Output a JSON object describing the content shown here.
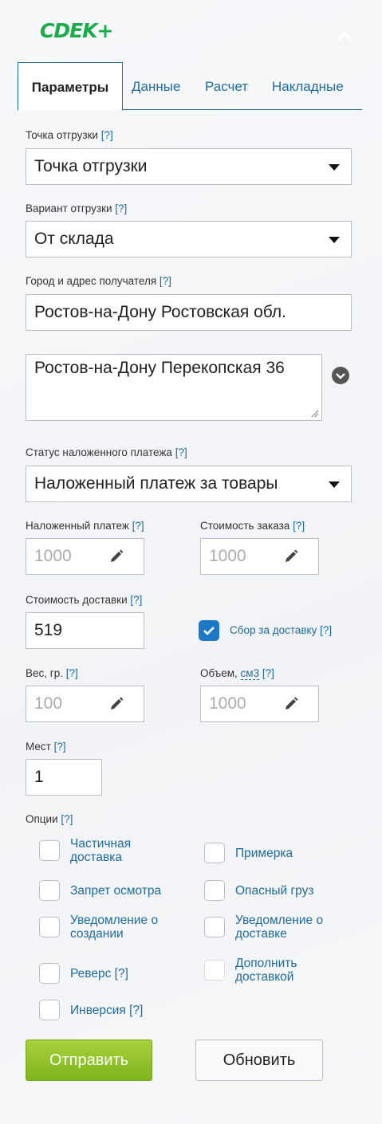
{
  "brand": {
    "logo": "CDEK+"
  },
  "tabs": [
    {
      "label": "Параметры"
    },
    {
      "label": "Данные"
    },
    {
      "label": "Расчет"
    },
    {
      "label": "Накладные"
    }
  ],
  "help": "[?]",
  "shipment_point": {
    "label": "Точка отгрузки",
    "value": "Точка отгрузки"
  },
  "shipment_variant": {
    "label": "Вариант отгрузки",
    "value": "От склада"
  },
  "recipient": {
    "label": "Город и адрес получателя",
    "city": "Ростов-на-Дону Ростовская обл.",
    "address": "Ростов-на-Дону Перекопская 36"
  },
  "cod_status": {
    "label": "Статус наложенного платежа",
    "value": "Наложенный платеж за товары"
  },
  "cod": {
    "label": "Наложенный платеж",
    "value": "1000"
  },
  "order_cost": {
    "label": "Стоимость заказа",
    "value": "1000"
  },
  "delivery_cost": {
    "label": "Стоимость доставки",
    "value": "519"
  },
  "delivery_fee": {
    "label": "Сбор за доставку",
    "checked": true
  },
  "weight": {
    "label": "Вес, гр.",
    "value": "100"
  },
  "volume": {
    "label": "Объем,",
    "unit": "см3",
    "value": "1000"
  },
  "places": {
    "label": "Мест",
    "value": "1"
  },
  "options": {
    "label": "Опции",
    "partial": "Частичная\nдоставка",
    "fitting": "Примерка",
    "no_inspection": "Запрет осмотра",
    "dangerous": "Опасный груз",
    "notify_create": "Уведомление о\nсоздании",
    "notify_delivery": "Уведомление о\nдоставке",
    "reverse": "Реверс",
    "add_delivery": "Дополнить\nдоставкой",
    "inversion": "Инверсия"
  },
  "buttons": {
    "send": "Отправить",
    "refresh": "Обновить"
  },
  "colors": {
    "brand": "#1aab4b",
    "link": "#1f6b9b",
    "checkbox": "#1e78c8",
    "send": "#8fc22a"
  }
}
